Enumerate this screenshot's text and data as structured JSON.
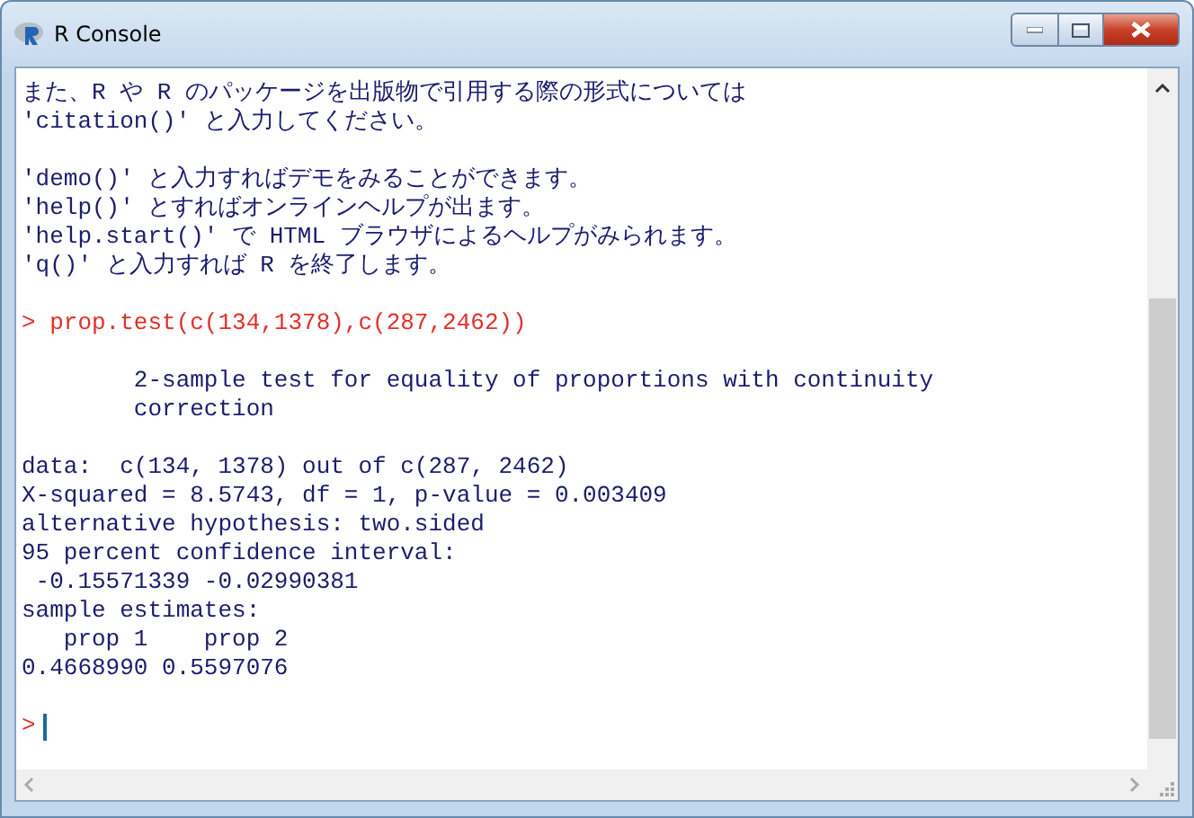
{
  "window": {
    "title": "R Console"
  },
  "console": {
    "lines": [
      {
        "kind": "output",
        "text": "また、R や R のパッケージを出版物で引用する際の形式については"
      },
      {
        "kind": "output",
        "text": "'citation()' と入力してください。"
      },
      {
        "kind": "blank"
      },
      {
        "kind": "output",
        "text": "'demo()' と入力すればデモをみることができます。"
      },
      {
        "kind": "output",
        "text": "'help()' とすればオンラインヘルプが出ます。"
      },
      {
        "kind": "output",
        "text": "'help.start()' で HTML ブラウザによるヘルプがみられます。"
      },
      {
        "kind": "output",
        "text": "'q()' と入力すれば R を終了します。"
      },
      {
        "kind": "blank"
      },
      {
        "kind": "input",
        "text": "> prop.test(c(134,1378),c(287,2462))"
      },
      {
        "kind": "blank"
      },
      {
        "kind": "output",
        "text": "        2-sample test for equality of proportions with continuity"
      },
      {
        "kind": "output",
        "text": "        correction"
      },
      {
        "kind": "blank"
      },
      {
        "kind": "output",
        "text": "data:  c(134, 1378) out of c(287, 2462)"
      },
      {
        "kind": "output",
        "text": "X-squared = 8.5743, df = 1, p-value = 0.003409"
      },
      {
        "kind": "output",
        "text": "alternative hypothesis: two.sided"
      },
      {
        "kind": "output",
        "text": "95 percent confidence interval:"
      },
      {
        "kind": "output",
        "text": " -0.15571339 -0.02990381"
      },
      {
        "kind": "output",
        "text": "sample estimates:"
      },
      {
        "kind": "output",
        "text": "   prop 1    prop 2 "
      },
      {
        "kind": "output",
        "text": "0.4668990 0.5597076 "
      },
      {
        "kind": "blank"
      },
      {
        "kind": "prompt",
        "text": ">"
      }
    ]
  }
}
